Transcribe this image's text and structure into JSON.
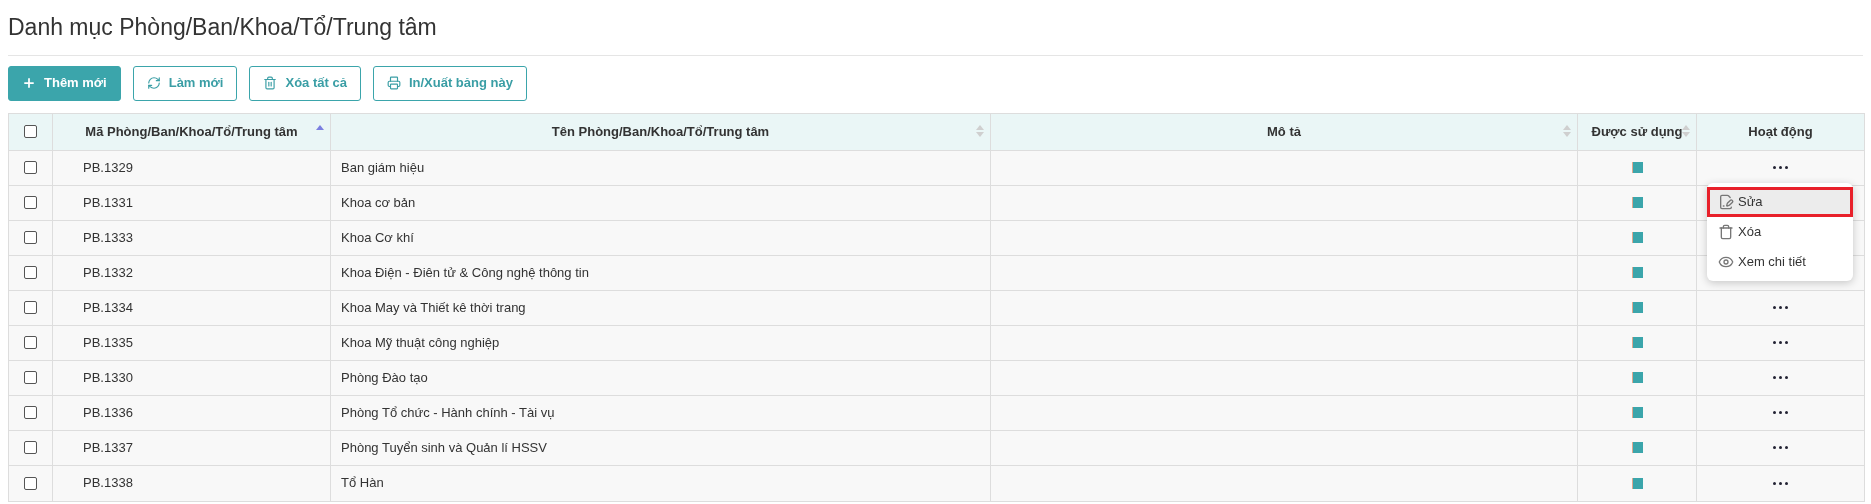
{
  "title": "Danh mục Phòng/Ban/Khoa/Tổ/Trung tâm",
  "toolbar": [
    {
      "kind": "add",
      "label": "Thêm mới"
    },
    {
      "kind": "refresh",
      "label": "Làm mới"
    },
    {
      "kind": "delete",
      "label": "Xóa tất cả"
    },
    {
      "kind": "print",
      "label": "In/Xuất bảng này"
    }
  ],
  "table": {
    "select_all": {
      "checked": false
    },
    "columns": [
      {
        "label": "Mã Phòng/Ban/Khoa/Tổ/Trung tâm",
        "sortable": true,
        "sorted_ascending": true
      },
      {
        "label": "Tên Phòng/Ban/Khoa/Tổ/Trung tâm",
        "sortable": true,
        "sorted_ascending": false
      },
      {
        "label": "Mô tả",
        "sortable": true,
        "sorted_ascending": false
      },
      {
        "label": "Được sử dụng",
        "sortable": true,
        "sorted_ascending": false
      },
      {
        "label": "Hoạt động",
        "sortable": false
      }
    ],
    "rows": [
      {
        "checked": false,
        "code": "PB.1329",
        "name": "Ban giám hiệu",
        "used": true,
        "menu_open": true
      },
      {
        "checked": false,
        "code": "PB.1331",
        "name": "Khoa cơ bản",
        "used": true,
        "menu_open": false,
        "actions_covered": true
      },
      {
        "checked": false,
        "code": "PB.1333",
        "name": "Khoa Cơ khí",
        "used": true,
        "menu_open": false,
        "actions_covered": true
      },
      {
        "checked": false,
        "code": "PB.1332",
        "name": "Khoa Điện - Điên tử & Công nghệ thông tin",
        "used": true,
        "menu_open": false,
        "actions_covered": true
      },
      {
        "checked": false,
        "code": "PB.1334",
        "name": "Khoa May và Thiết kê thời trang",
        "used": true,
        "menu_open": false
      },
      {
        "checked": false,
        "code": "PB.1335",
        "name": "Khoa Mỹ thuật công nghiệp",
        "used": true,
        "menu_open": false
      },
      {
        "checked": false,
        "code": "PB.1330",
        "name": "Phòng Đào tạo",
        "used": true,
        "menu_open": false
      },
      {
        "checked": false,
        "code": "PB.1336",
        "name": "Phòng Tổ chức - Hành chính - Tài vụ",
        "used": true,
        "menu_open": false
      },
      {
        "checked": false,
        "code": "PB.1337",
        "name": "Phòng Tuyển sinh và Quản lí HSSV",
        "used": true,
        "menu_open": false
      },
      {
        "checked": false,
        "code": "PB.1338",
        "name": "Tổ Hàn",
        "used": true,
        "menu_open": false
      }
    ]
  },
  "action_menu": [
    {
      "kind": "edit",
      "label": "Sửa",
      "selected": true
    },
    {
      "kind": "delete",
      "label": "Xóa",
      "selected": false
    },
    {
      "kind": "view",
      "label": "Xem chi tiết",
      "selected": false
    }
  ]
}
